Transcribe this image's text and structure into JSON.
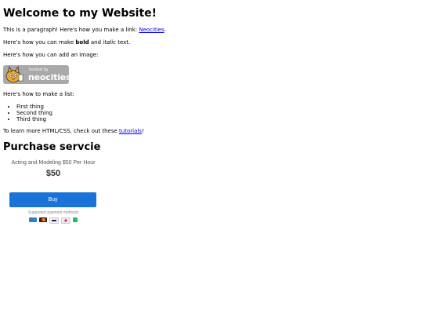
{
  "page": {
    "heading": "Welcome to my Website!",
    "intro_before_link": "This is a paragraph! Here's how you make a link: ",
    "intro_link": "Neocities",
    "intro_after_link": ".",
    "format_before_bold": "Here's how you can make ",
    "format_bold": "bold",
    "format_between": " and ",
    "format_italic": "italic",
    "format_after": " text.",
    "image_intro": "Here's how you can add an image:",
    "badge_hosted": "hosted by",
    "badge_brand": "neocities",
    "list_intro": "Here's how to make a list:",
    "list_items": [
      "First thing",
      "Second thing",
      "Third thing"
    ],
    "learn_before_link": "To learn more HTML/CSS, check out these ",
    "learn_link": "tutorials",
    "learn_after_link": "!",
    "purchase_heading": "Purchase servcie"
  },
  "checkout": {
    "product_name": "Acting and Modeling $50 Per Hour",
    "price": "$50",
    "buy_label": "Buy",
    "supported_label": "Supported payment methods",
    "payment_icons": [
      {
        "name": "card-icon",
        "color": "#2f7fd1"
      },
      {
        "name": "mastercard-icon",
        "color": "#eb6c0f"
      },
      {
        "name": "visa-icon",
        "color": "#1a1f71"
      },
      {
        "name": "unionpay-icon",
        "color": "#d8d8e8"
      },
      {
        "name": "wallet-icon",
        "color": "#1fbf5a"
      }
    ]
  }
}
